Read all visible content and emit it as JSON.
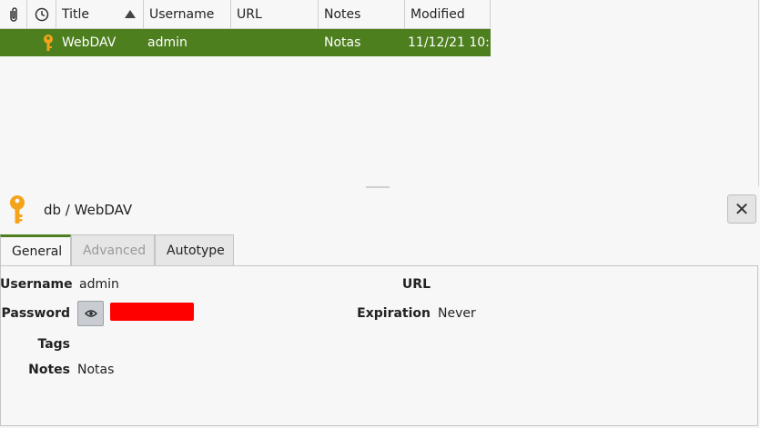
{
  "table": {
    "columns": [
      {
        "name": "attachment",
        "icon": "paperclip-icon",
        "label": ""
      },
      {
        "name": "expiry",
        "icon": "clock-icon",
        "label": ""
      },
      {
        "name": "title",
        "label": "Title"
      },
      {
        "name": "username",
        "label": "Username"
      },
      {
        "name": "url",
        "label": "URL"
      },
      {
        "name": "notes",
        "label": "Notes"
      },
      {
        "name": "modified",
        "label": "Modified"
      }
    ],
    "sort_column": "Title",
    "rows": [
      {
        "title": "WebDAV",
        "username": "admin",
        "url": "",
        "notes": "Notas",
        "modified": "11/12/21 10:…",
        "icon": "key-icon"
      }
    ]
  },
  "details": {
    "path": "db / WebDAV",
    "tabs": [
      {
        "label": "General",
        "active": true
      },
      {
        "label": "Advanced",
        "disabled": true
      },
      {
        "label": "Autotype"
      }
    ],
    "fields": {
      "username_label": "Username",
      "username_value": "admin",
      "password_label": "Password",
      "tags_label": "Tags",
      "tags_value": "",
      "notes_label": "Notes",
      "notes_value": "Notas",
      "url_label": "URL",
      "url_value": "",
      "expiration_label": "Expiration",
      "expiration_value": "Never"
    }
  },
  "colors": {
    "selection": "#4d7f1e",
    "key": "#f5a31a",
    "accent": "#4d7f1e",
    "redaction": "#ff0000"
  }
}
